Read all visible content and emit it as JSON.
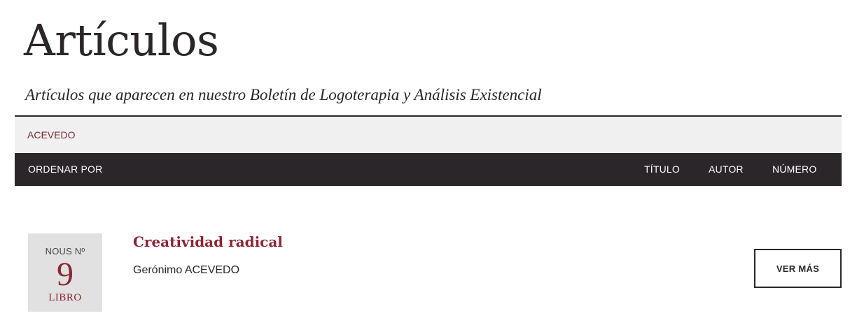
{
  "header": {
    "title": "Artículos",
    "subtitle": "Artículos que aparecen en nuestro Boletín de Logoterapia y Análisis Existencial"
  },
  "search": {
    "value": "ACEVEDO"
  },
  "sort": {
    "label": "ORDENAR POR",
    "options": [
      "TÍTULO",
      "AUTOR",
      "NÚMERO"
    ]
  },
  "articles": [
    {
      "issue_label": "NOUS Nº",
      "issue_number": "9",
      "issue_type": "LIBRO",
      "title": "Creatividad radical",
      "author": "Gerónimo ACEVEDO",
      "more_label": "VER MÁS"
    }
  ],
  "colors": {
    "accent": "#8c2533",
    "dark": "#2b2629",
    "search_bg": "#f0f0f0",
    "badge_bg": "#e1e1e1"
  }
}
